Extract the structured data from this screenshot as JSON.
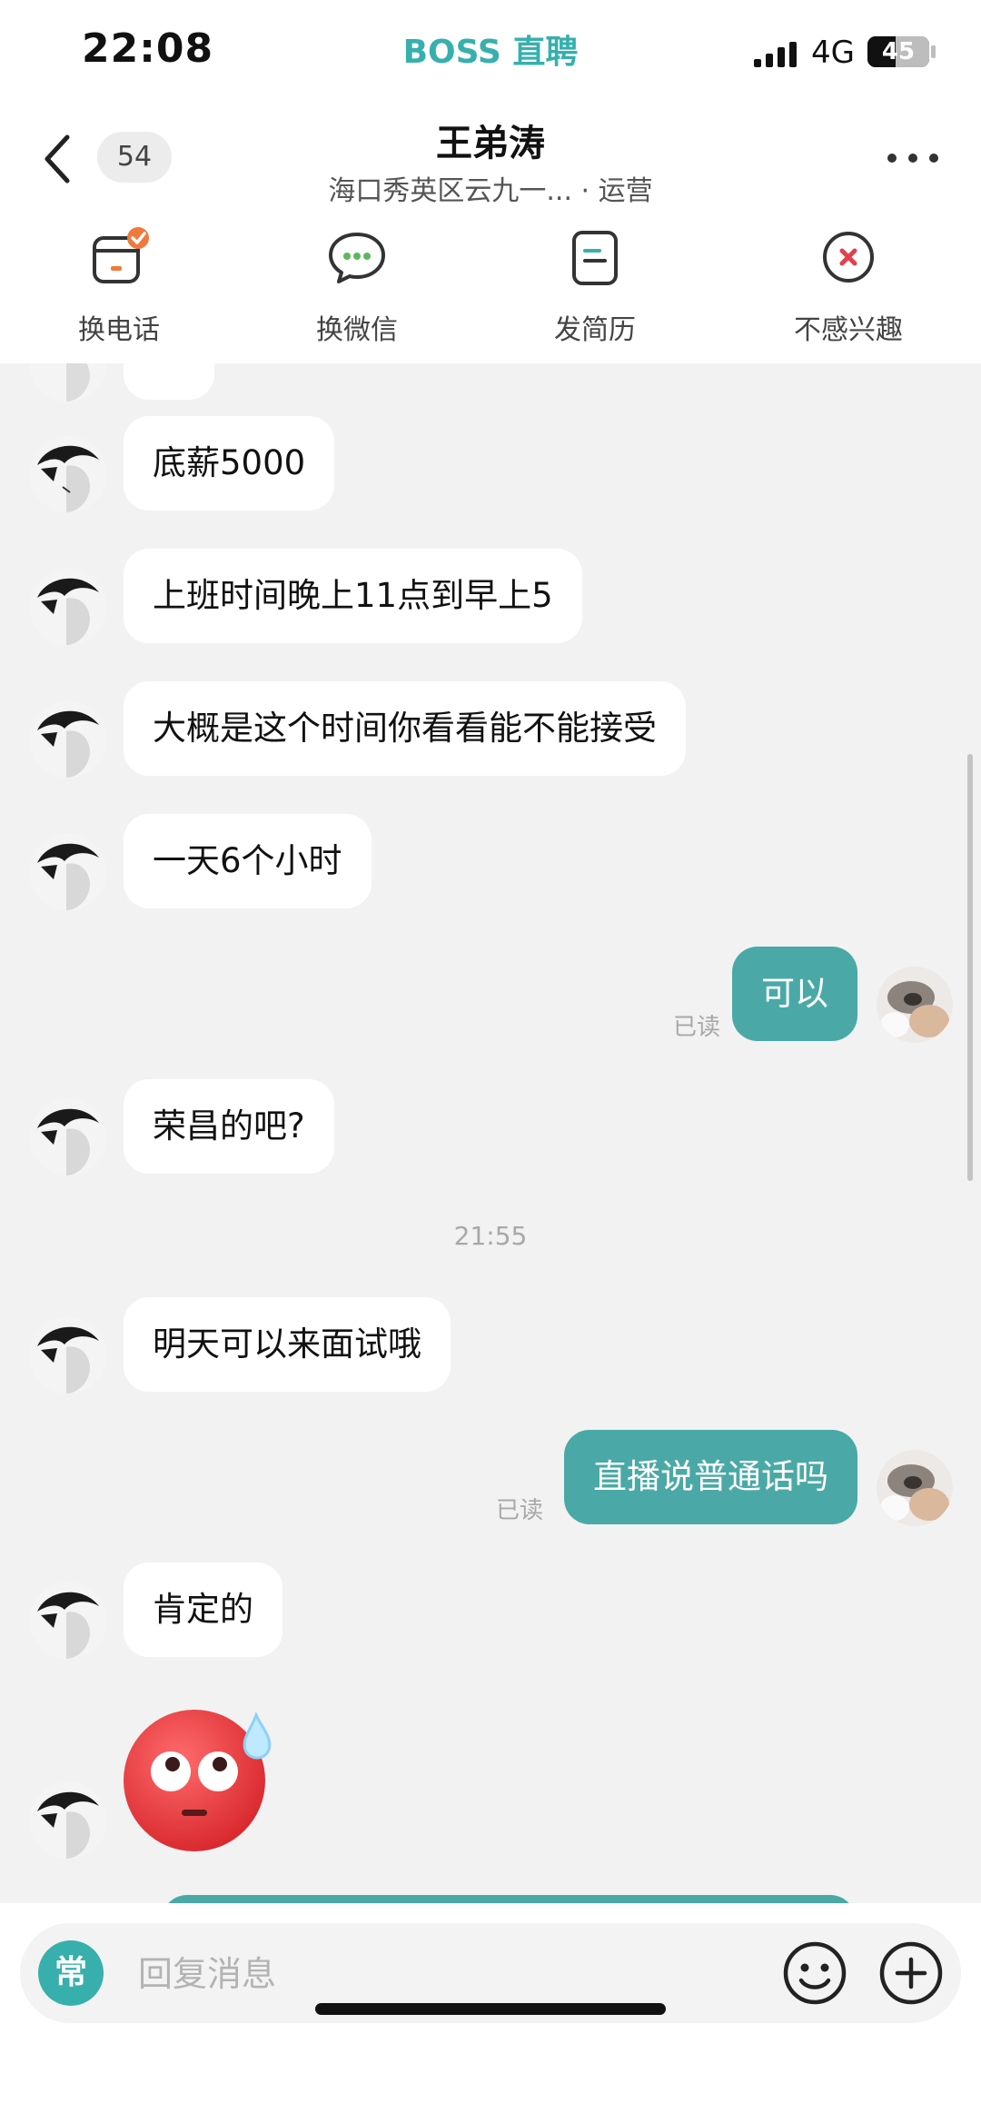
{
  "status_bar": {
    "time": "22:08",
    "brand": "BOSS 直聘",
    "network": "4G",
    "battery": "45",
    "battery_level": 0.45
  },
  "header": {
    "unread_count": "54",
    "contact_name": "王弟涛",
    "subtitle": "海口秀英区云九一... · 运营",
    "actions": [
      {
        "label": "换电话",
        "icon": "phone-card-icon"
      },
      {
        "label": "换微信",
        "icon": "wechat-icon"
      },
      {
        "label": "发简历",
        "icon": "resume-icon"
      },
      {
        "label": "不感兴趣",
        "icon": "not-interested-icon"
      }
    ]
  },
  "messages": [
    {
      "side": "in",
      "text": "底薪5000"
    },
    {
      "side": "in",
      "text": "上班时间晚上11点到早上5"
    },
    {
      "side": "in",
      "text": "大概是这个时间你看看能不能接受"
    },
    {
      "side": "in",
      "text": "一天6个小时"
    },
    {
      "side": "out",
      "text": "可以",
      "status": "已读"
    },
    {
      "side": "in",
      "text": "荣昌的吧?"
    },
    {
      "timestamp": "21:55"
    },
    {
      "side": "in",
      "text": "明天可以来面试哦"
    },
    {
      "side": "out",
      "text": "直播说普通话吗",
      "status": "已读"
    },
    {
      "side": "in",
      "text": "肯定的"
    },
    {
      "side": "in",
      "sticker": "flushed-sweat-emoji"
    }
  ],
  "input": {
    "quick_reply_label": "常",
    "placeholder": "回复消息"
  },
  "colors": {
    "brand": "#37b0ad",
    "outgoing_bubble": "#4aa9a6",
    "background": "#f2f2f2",
    "not_interested_red": "#e0424b",
    "call_badge_orange": "#f07a3c"
  }
}
